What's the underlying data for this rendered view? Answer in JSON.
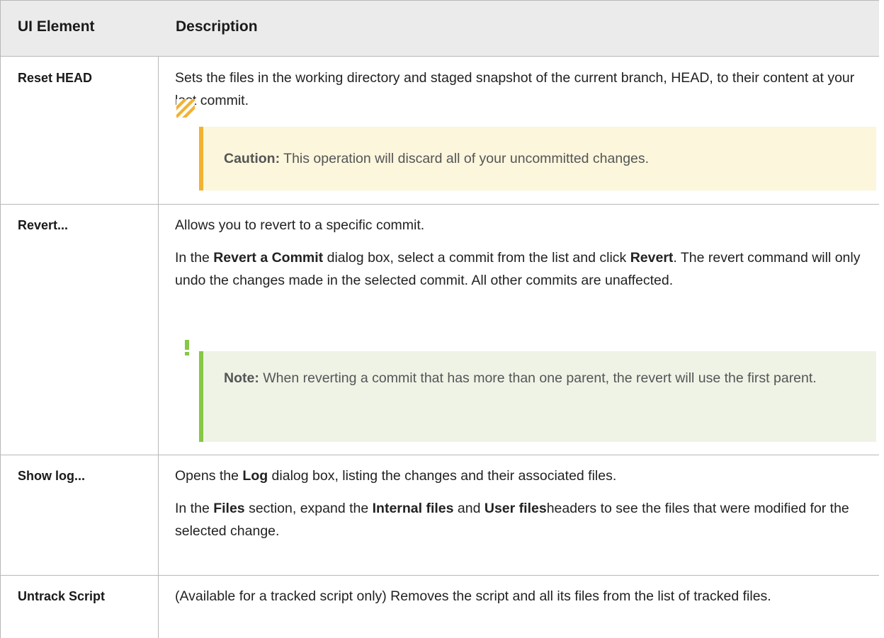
{
  "table": {
    "headers": [
      "UI Element",
      "Description"
    ],
    "rows": [
      {
        "name": "Reset HEAD",
        "paragraphs": [
          [
            "Sets the files in the working directory and staged snapshot of the current branch, HEAD, to their content at your last commit."
          ]
        ],
        "callout": {
          "type": "caution",
          "label": "Caution:",
          "text": "This operation will discard all of your uncommitted changes.",
          "icon": "caution-stripes-icon",
          "color": "#f2b233"
        }
      },
      {
        "name": "Revert...",
        "paragraphs": [
          [
            "Allows you to revert to a specific commit."
          ],
          [
            "In the ",
            {
              "b": "Revert a Commit"
            },
            " dialog box, select a commit from the list and click ",
            {
              "b": "Revert"
            },
            ". The revert command will only undo the changes made in the selected commit. All other commits are unaffected."
          ]
        ],
        "callout": {
          "type": "note",
          "label": "Note:",
          "text": "When reverting a commit that has more than one parent, the revert will use the first parent.",
          "icon": "exclamation-icon",
          "color": "#86c744"
        }
      },
      {
        "name": "Show log...",
        "paragraphs": [
          [
            "Opens the ",
            {
              "b": "Log"
            },
            " dialog box, listing the changes and their associated files."
          ],
          [
            "In the ",
            {
              "b": "Files"
            },
            " section, expand the ",
            {
              "b": "Internal files"
            },
            " and ",
            {
              "b": "User files"
            },
            "headers to see the files that were modified for the selected change."
          ]
        ]
      },
      {
        "name": "Untrack Script",
        "paragraphs": [
          [
            "(Available for a tracked script only) Removes the script and all its files from the list of tracked files."
          ]
        ]
      }
    ]
  }
}
